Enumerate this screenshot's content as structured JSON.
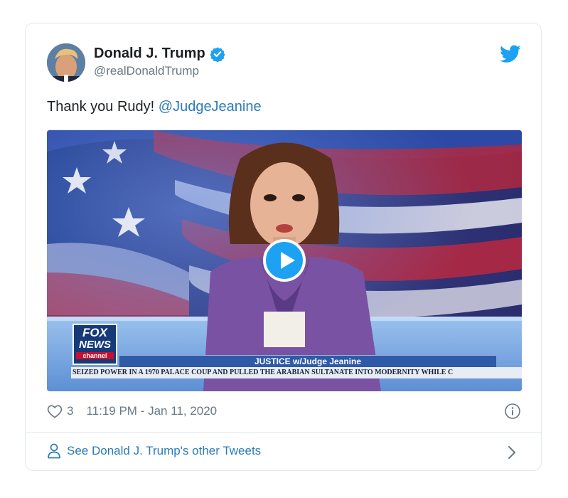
{
  "tweet": {
    "author": {
      "display_name": "Donald J. Trump",
      "handle": "@realDonaldTrump",
      "verified": true
    },
    "text": "Thank you Rudy!",
    "mention": "@JudgeJeanine",
    "media": {
      "type": "video",
      "channel_logo_line1": "FOX",
      "channel_logo_line2": "NEWS",
      "channel_logo_line3": "channel",
      "show_title": "JUSTICE w/Judge Jeanine",
      "ticker_text": "SEIZED POWER IN A 1970 PALACE COUP AND PULLED THE ARABIAN SULTANATE INTO MODERNITY WHILE C"
    },
    "like_count": "3",
    "timestamp": "11:19 PM - Jan 11, 2020",
    "more_link": "See Donald J. Trump's other Tweets"
  },
  "colors": {
    "link": "#2b7bb9",
    "brand": "#1da1f2",
    "muted": "#697882",
    "border": "#e1e8ed"
  },
  "icons": [
    "verified-badge-icon",
    "twitter-bird-icon",
    "play-icon",
    "heart-icon",
    "info-icon",
    "person-icon",
    "chevron-right-icon"
  ]
}
